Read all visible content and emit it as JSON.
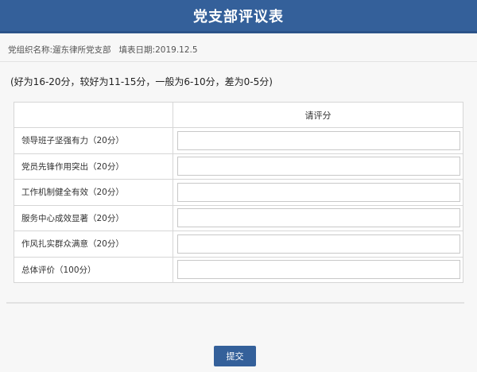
{
  "header": {
    "title": "党支部评议表"
  },
  "meta": {
    "org_label": "党组织名称:",
    "org_value": "遛东律所党支部",
    "date_label": "填表日期:",
    "date_value": "2019.12.5"
  },
  "scoring_note": "(好为16-20分，较好为11-15分，一般为6-10分，差为0-5分)",
  "table": {
    "item_header": "",
    "score_header": "请评分",
    "rows": [
      {
        "label": "领导班子坚强有力（20分）",
        "score": ""
      },
      {
        "label": "党员先锋作用突出（20分）",
        "score": ""
      },
      {
        "label": "工作机制健全有效（20分）",
        "score": ""
      },
      {
        "label": "服务中心成效显著（20分）",
        "score": ""
      },
      {
        "label": "作风扎实群众满意（20分）",
        "score": ""
      },
      {
        "label": "总体评价（100分）",
        "score": ""
      }
    ]
  },
  "submit_label": "提交",
  "colors": {
    "brand": "#34609a"
  }
}
